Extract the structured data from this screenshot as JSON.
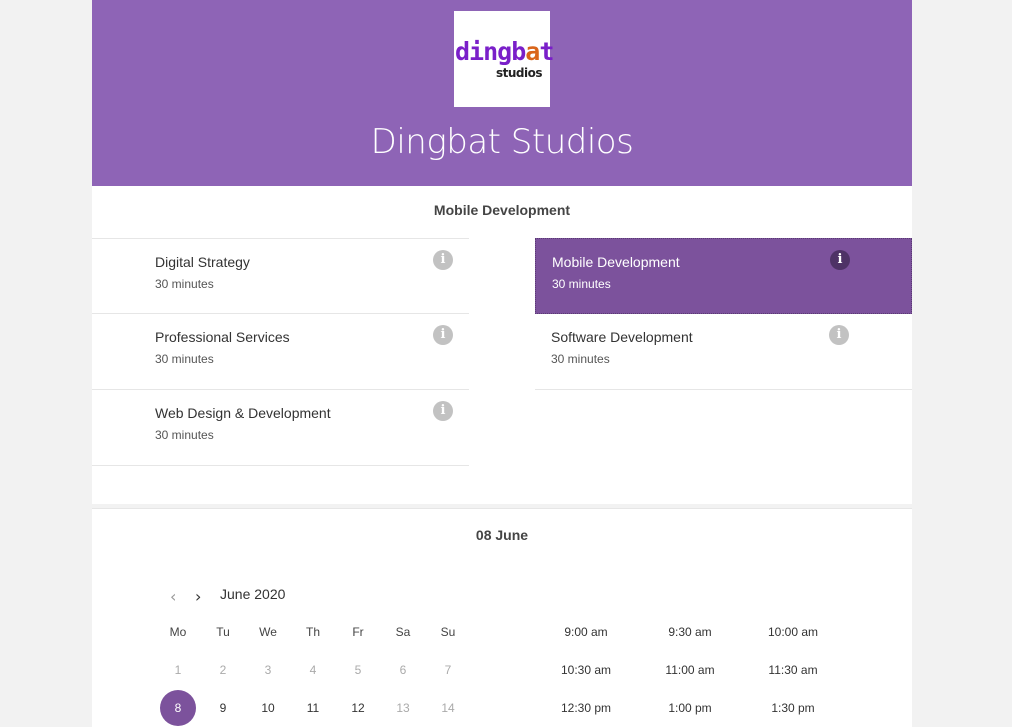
{
  "header": {
    "logo_text_main": "dingbat",
    "logo_text_sub": "studios",
    "business_name": "Dingbat Studios",
    "background_color": "#8e64b6"
  },
  "services": {
    "title": "Mobile Development",
    "items": [
      {
        "name": "Digital Strategy",
        "duration": "30 minutes",
        "selected": false
      },
      {
        "name": "Mobile Development",
        "duration": "30 minutes",
        "selected": true
      },
      {
        "name": "Professional Services",
        "duration": "30 minutes",
        "selected": false
      },
      {
        "name": "Software Development",
        "duration": "30 minutes",
        "selected": false
      },
      {
        "name": "Web Design & Development",
        "duration": "30 minutes",
        "selected": false
      }
    ],
    "info_icon": "info-icon",
    "selected_color": "#7c529c"
  },
  "calendar": {
    "selected_date_title": "08 June",
    "month_label": "June 2020",
    "prev_icon": "chevron-left-icon",
    "next_icon": "chevron-right-icon",
    "weekdays": [
      "Mo",
      "Tu",
      "We",
      "Th",
      "Fr",
      "Sa",
      "Su"
    ],
    "days": [
      "1",
      "2",
      "3",
      "4",
      "5",
      "6",
      "7",
      "8",
      "9",
      "10",
      "11",
      "12",
      "13",
      "14"
    ],
    "selected_day": "8"
  },
  "time_slots": [
    "9:00 am",
    "9:30 am",
    "10:00 am",
    "10:30 am",
    "11:00 am",
    "11:30 am",
    "12:30 pm",
    "1:00 pm",
    "1:30 pm"
  ]
}
